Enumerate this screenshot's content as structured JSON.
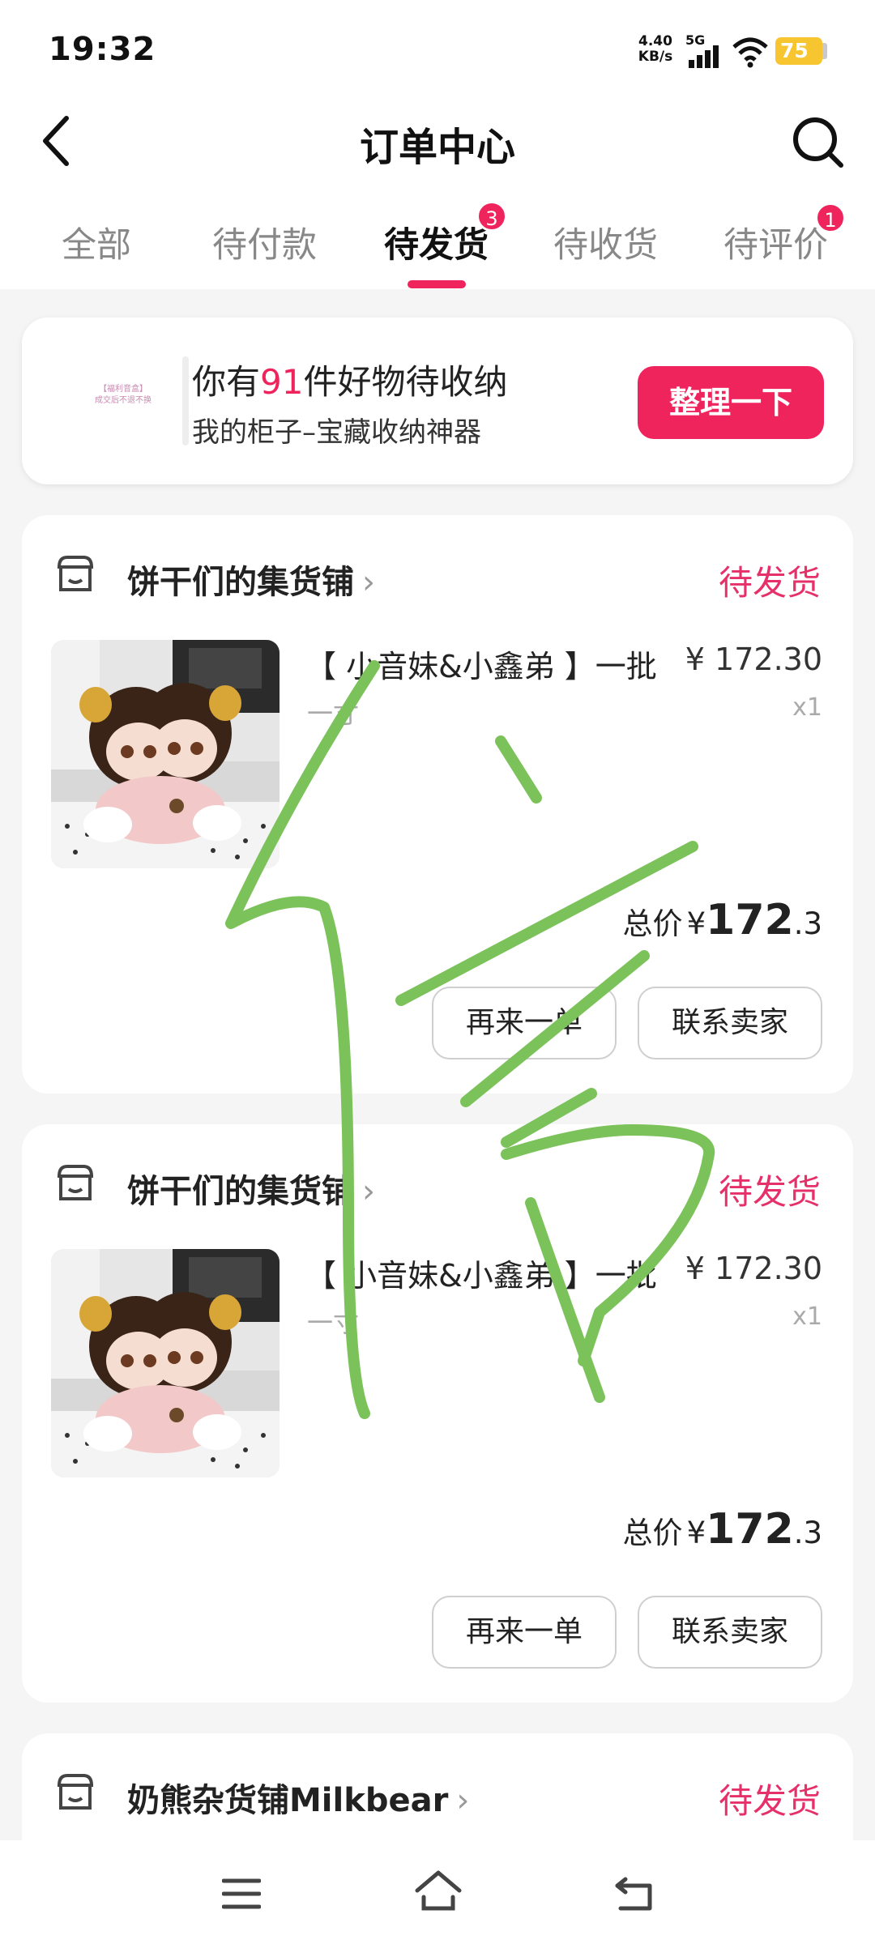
{
  "status_bar": {
    "time": "19:32",
    "net_speed_value": "4.40",
    "net_speed_unit": "KB/s",
    "network": "5G",
    "battery": "75"
  },
  "header": {
    "title": "订单中心",
    "back_icon": "chevron-left-icon",
    "search_icon": "search-icon"
  },
  "tabs": [
    {
      "label": "全部"
    },
    {
      "label": "待付款"
    },
    {
      "label": "待发货",
      "active": true,
      "badge": "3"
    },
    {
      "label": "待收货"
    },
    {
      "label": "待评价",
      "badge": "1"
    }
  ],
  "promo": {
    "thumb_line1": "【福利音盒】",
    "thumb_line2": "成交后不退不换",
    "title_prefix": "你有",
    "title_count": "91",
    "title_suffix": "件好物待收纳",
    "subtitle": "我的柜子–宝藏收纳神器",
    "button": "整理一下"
  },
  "orders": [
    {
      "shop": "饼干们的集货铺",
      "status": "待发货",
      "product_title": "【 小音妹&小鑫弟 】一批",
      "spec": "一寸",
      "price": "¥ 172.30",
      "qty": "x1",
      "total_label": "总价",
      "total_symbol": "¥",
      "total_int": "172",
      "total_dec": ".3",
      "buttons": [
        "再来一单",
        "联系卖家"
      ]
    },
    {
      "shop": "饼干们的集货铺",
      "status": "待发货",
      "product_title": "【 小音妹&小鑫弟 】一批",
      "spec": "一寸",
      "price": "¥ 172.30",
      "qty": "x1",
      "total_label": "总价",
      "total_symbol": "¥",
      "total_int": "172",
      "total_dec": ".3",
      "buttons": [
        "再来一单",
        "联系卖家"
      ]
    },
    {
      "shop": "奶熊杂货铺Milkbear",
      "status": "待发货"
    }
  ],
  "colors": {
    "accent": "#f0245d",
    "status_text": "#e5306a",
    "scribble": "#7cc25a",
    "battery": "#f7c52f"
  },
  "bottom_nav": {
    "icons": [
      "menu-icon",
      "home-icon",
      "back-icon"
    ]
  }
}
